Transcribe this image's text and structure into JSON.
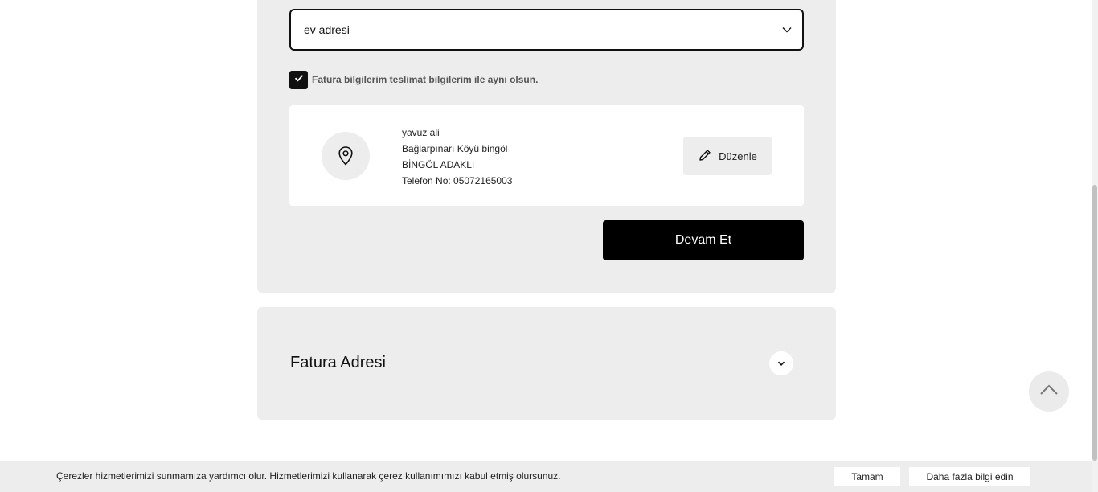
{
  "delivery": {
    "address_select": {
      "selected": "ev adresi"
    },
    "same_billing_checkbox": {
      "checked": true,
      "label": "Fatura bilgilerim teslimat bilgilerim ile aynı olsun."
    },
    "address_card": {
      "name": "yavuz ali",
      "street": "Bağlarpınarı Köyü bingöl",
      "city": "BİNGÖL ADAKLI",
      "phone": "Telefon No: 05072165003",
      "edit_label": "Düzenle"
    },
    "continue_label": "Devam Et"
  },
  "invoice_section": {
    "title": "Fatura Adresi",
    "icon": "chevron-down-icon"
  },
  "scroll_top": {
    "icon": "chevron-up-icon"
  },
  "cookie_bar": {
    "text": "Çerezler hizmetlerimizi sunmamıza yardımcı olur. Hizmetlerimizi kullanarak çerez kullanımımızı kabul etmiş olursunuz.",
    "accept_label": "Tamam",
    "more_label": "Daha fazla bilgi edin"
  },
  "colors": {
    "panel_bg": "#ededed",
    "primary_button": "#000000",
    "card_bg": "#ffffff"
  }
}
